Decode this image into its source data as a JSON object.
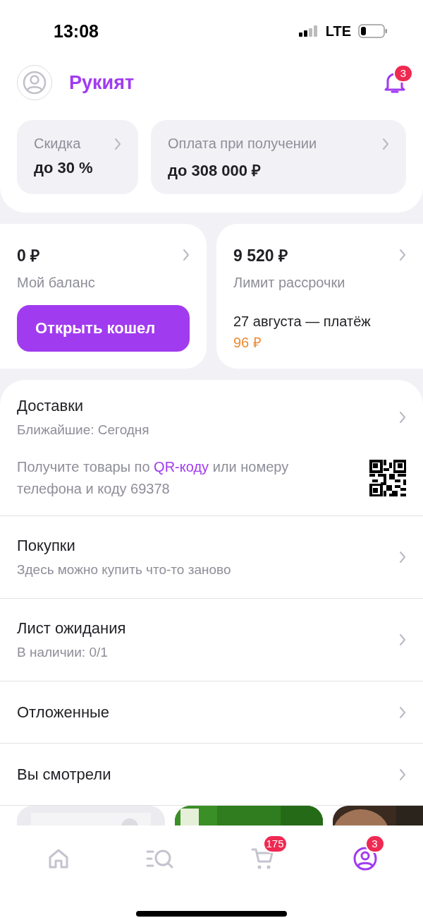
{
  "status_bar": {
    "time": "13:08",
    "network": "LTE"
  },
  "header": {
    "name": "Рукият",
    "notifications": "3"
  },
  "perks": [
    {
      "label": "Скидка",
      "value": "до 30 %"
    },
    {
      "label": "Оплата при получении",
      "value": "до 308 000 ₽"
    }
  ],
  "wallet": {
    "amount": "0 ₽",
    "label": "Мой баланс",
    "button": "Открыть кошел"
  },
  "installment": {
    "amount": "9 520 ₽",
    "label": "Лимит рассрочки",
    "due": "27 августа — платёж",
    "payment": "96 ₽"
  },
  "menu": [
    {
      "kind": "delivery",
      "title": "Доставки",
      "subtitle": "Ближайшие: Сегодня",
      "note": {
        "before": "Получите товары по ",
        "link": "QR-коду",
        "after": " или номеру телефона и коду 69378"
      }
    },
    {
      "kind": "plain",
      "title": "Покупки",
      "subtitle": "Здесь можно купить что-то заново"
    },
    {
      "kind": "plain",
      "title": "Лист ожидания",
      "subtitle": "В наличии: 0/1"
    },
    {
      "kind": "plain",
      "title": "Отложенные"
    },
    {
      "kind": "plain",
      "title": "Вы смотрели"
    }
  ],
  "tab_bar": [
    {
      "kind": "home",
      "selected": false
    },
    {
      "kind": "catalog",
      "selected": false
    },
    {
      "kind": "cart",
      "selected": false,
      "badge": "175"
    },
    {
      "kind": "profile",
      "selected": true,
      "badge": "3"
    }
  ]
}
